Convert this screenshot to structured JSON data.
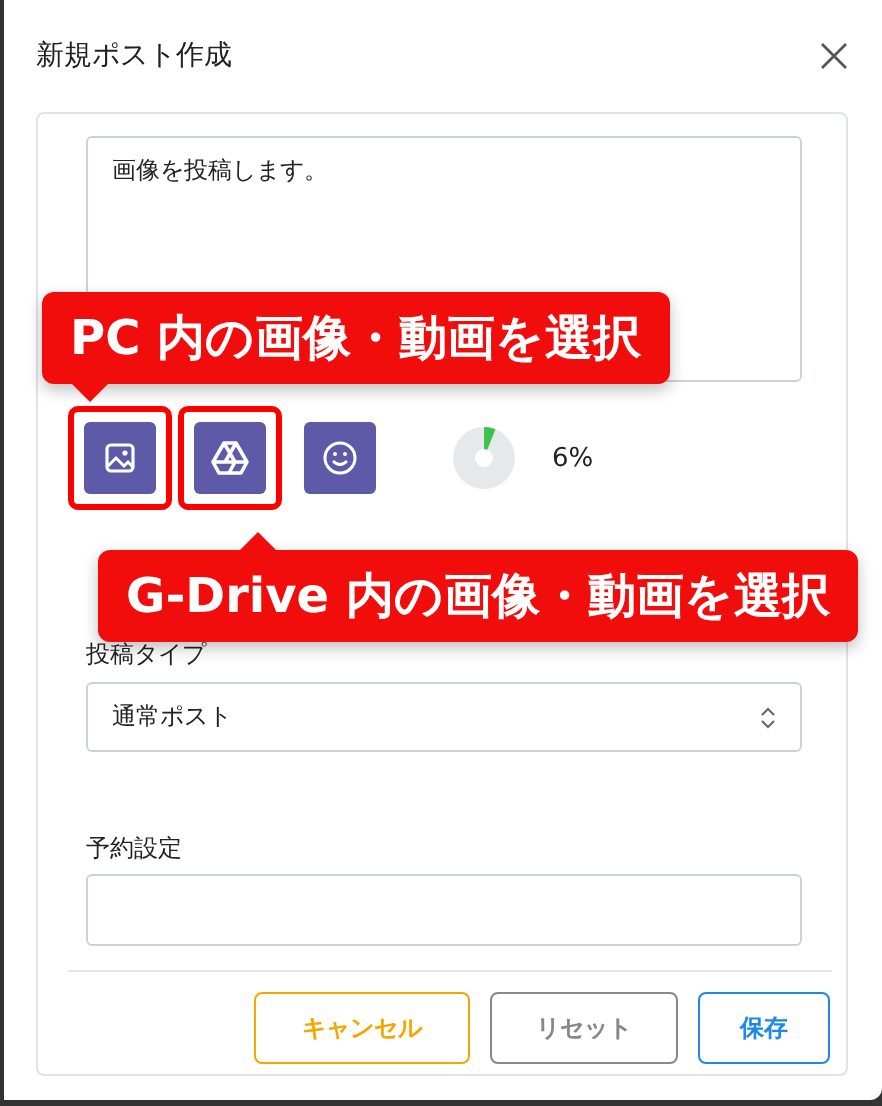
{
  "dialog": {
    "title": "新規ポスト作成"
  },
  "post_text": {
    "value": "画像を投稿します。"
  },
  "tools": [
    {
      "kind": "image",
      "highlighted": true
    },
    {
      "kind": "drive",
      "highlighted": true
    },
    {
      "kind": "emoji",
      "highlighted": false
    }
  ],
  "progress": {
    "reading": "6%"
  },
  "callouts": [
    {
      "text": "PC 内の画像・動画を選択"
    },
    {
      "text": "G-Drive 内の画像・動画を選択"
    }
  ],
  "post_type": {
    "label": "投稿タイプ",
    "value": "通常ポスト"
  },
  "schedule": {
    "label": "予約設定"
  },
  "buttons": [
    {
      "label": "キャンセル",
      "kind": "cancel"
    },
    {
      "label": "リセット",
      "kind": "reset"
    },
    {
      "label": "保存",
      "kind": "save"
    }
  ]
}
